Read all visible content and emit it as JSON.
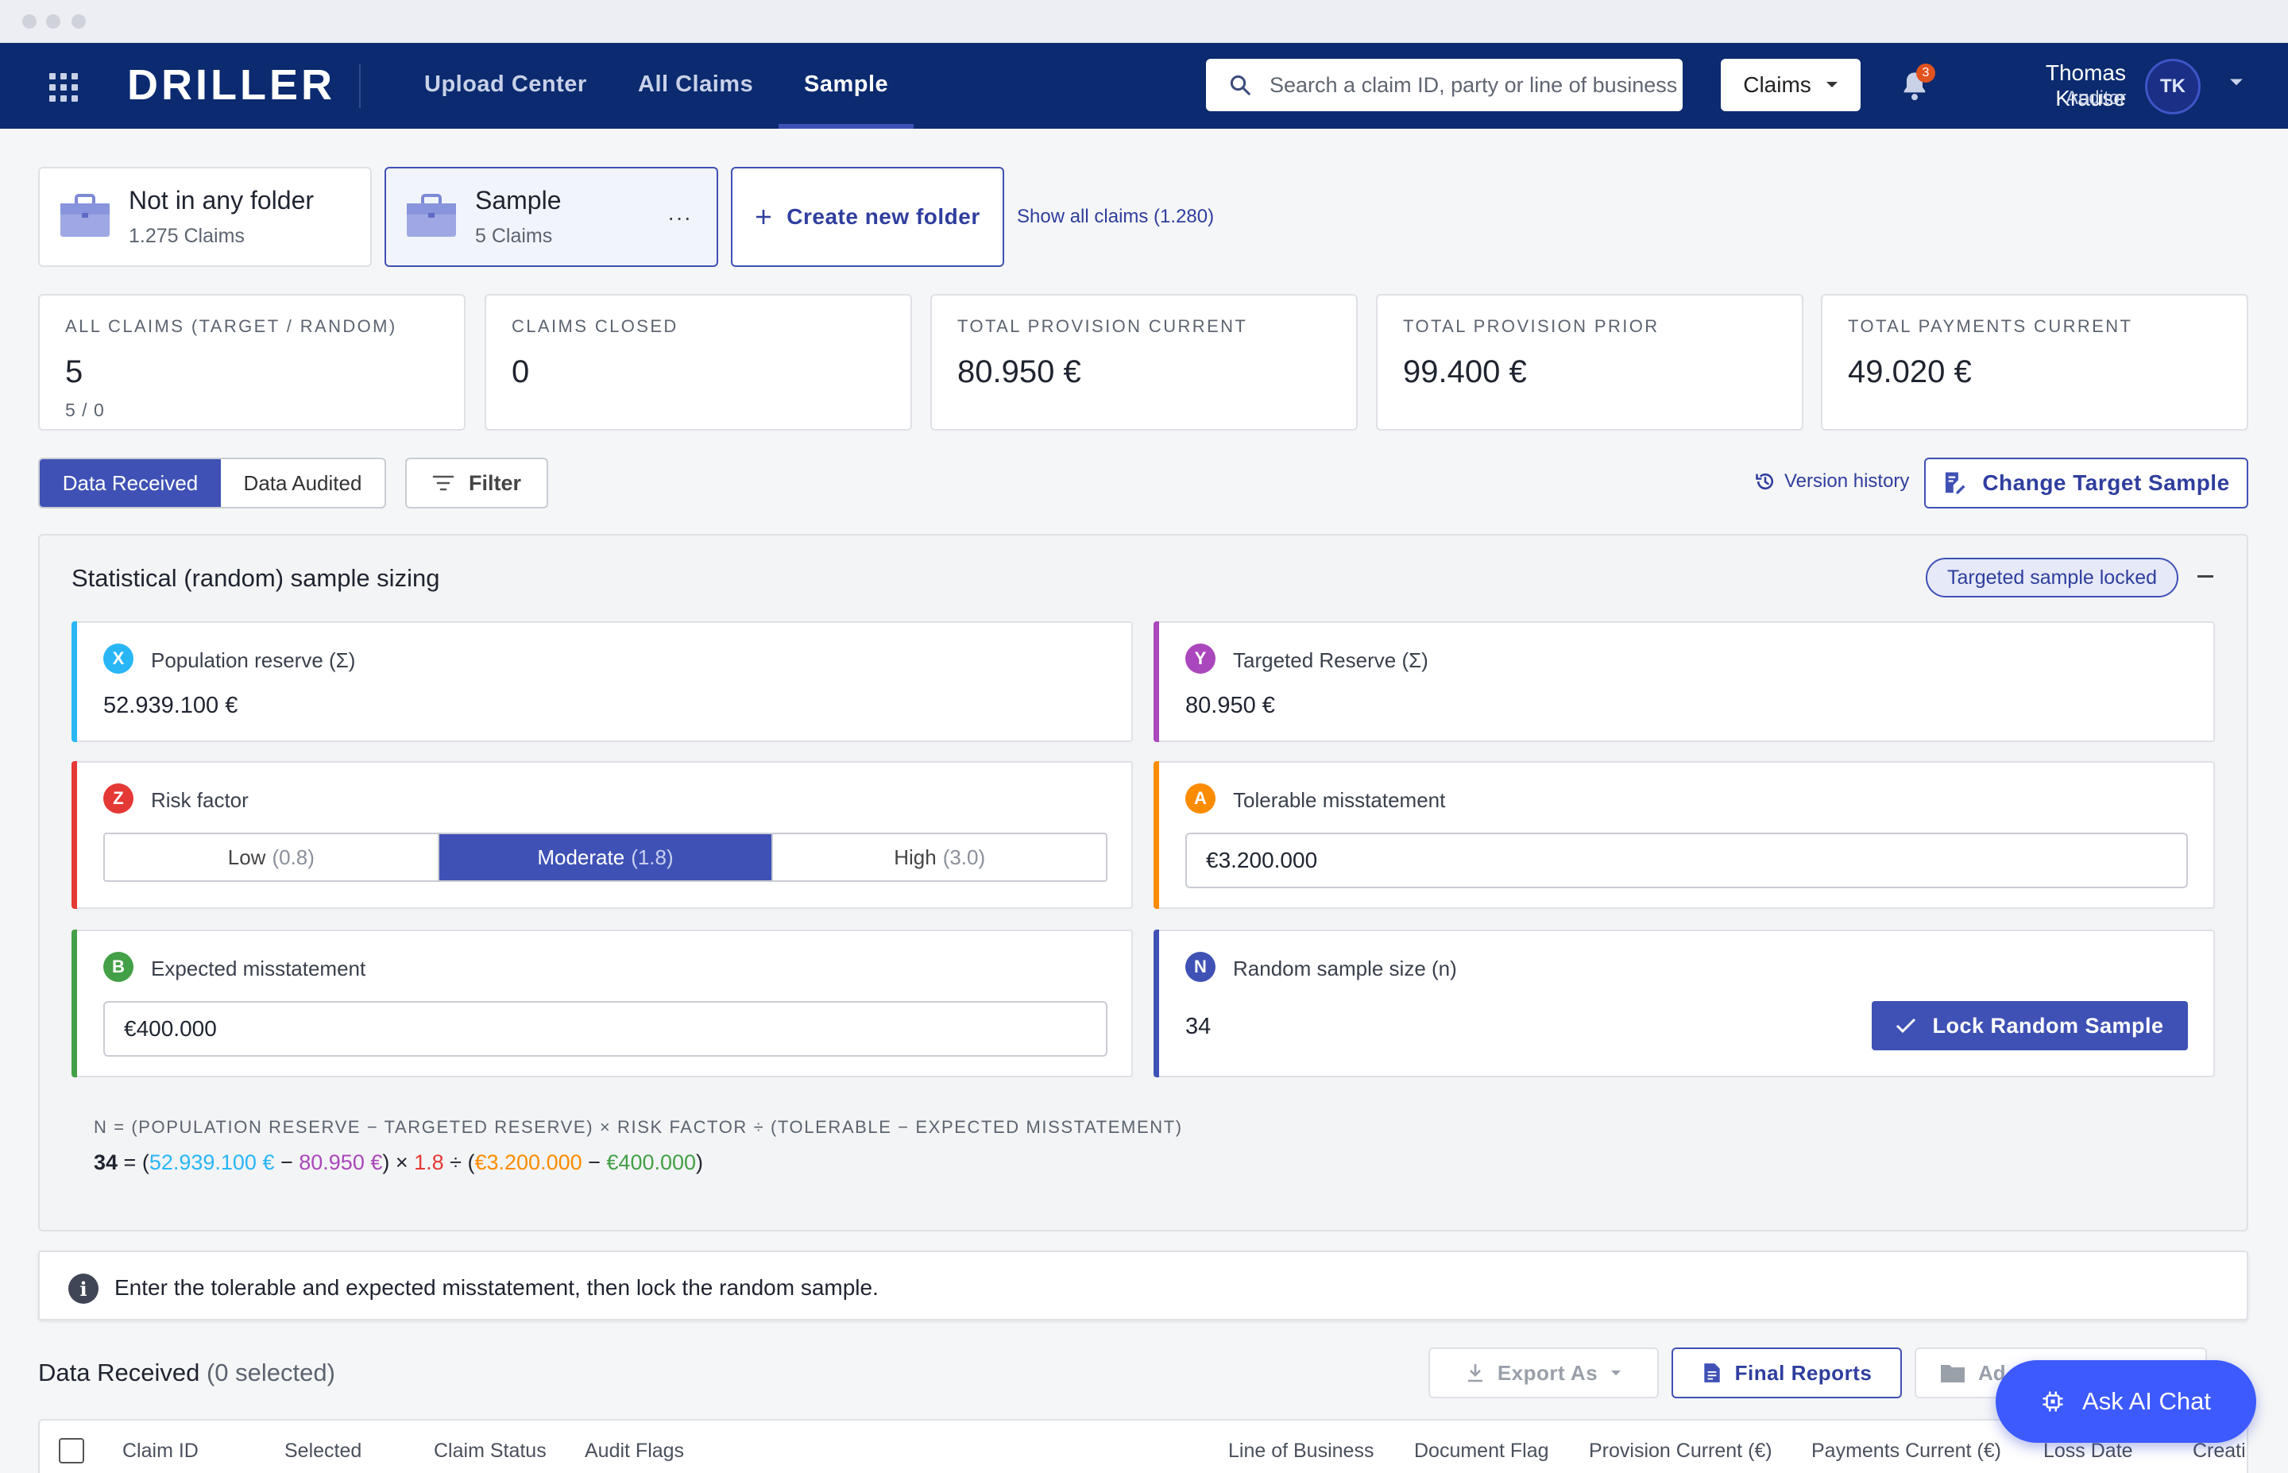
{
  "nav": {
    "brand": "DRILLER",
    "links": [
      "Upload Center",
      "All Claims",
      "Sample"
    ],
    "active_link": "Sample",
    "search_placeholder": "Search a claim ID, party or line of business",
    "scope": "Claims",
    "notifications": "3",
    "user": {
      "name": "Thomas Krause",
      "role": "Auditor",
      "initials": "TK"
    }
  },
  "folders": [
    {
      "name": "Not in any folder",
      "count": "1.275 Claims",
      "selected": false
    },
    {
      "name": "Sample",
      "count": "5 Claims",
      "selected": true,
      "menu": "···"
    }
  ],
  "create_folder_label": "Create new folder",
  "show_all_label": "Show all claims (1.280)",
  "stats": [
    {
      "label": "ALL CLAIMS (TARGET / RANDOM)",
      "value": "5",
      "sub": "5 / 0"
    },
    {
      "label": "CLAIMS CLOSED",
      "value": "0"
    },
    {
      "label": "TOTAL PROVISION CURRENT",
      "value": "80.950 €"
    },
    {
      "label": "TOTAL PROVISION PRIOR",
      "value": "99.400 €"
    },
    {
      "label": "TOTAL PAYMENTS CURRENT",
      "value": "49.020 €"
    }
  ],
  "toolbar": {
    "tabs": [
      "Data Received",
      "Data Audited"
    ],
    "active_tab": "Data Received",
    "filter_label": "Filter",
    "version_history": "Version history",
    "change_target": "Change Target Sample"
  },
  "sizing": {
    "title": "Statistical (random) sample sizing",
    "status_pill": "Targeted sample locked",
    "population": {
      "letter": "X",
      "label": "Population reserve (Σ)",
      "value": "52.939.100 €",
      "color": "#29b6f6"
    },
    "targeted": {
      "letter": "Y",
      "label": "Targeted Reserve (Σ)",
      "value": "80.950 €",
      "color": "#ab47bc"
    },
    "risk": {
      "letter": "Z",
      "label": "Risk factor",
      "color": "#e53935",
      "options": [
        {
          "label": "Low",
          "mult": "(0.8)"
        },
        {
          "label": "Moderate",
          "mult": "(1.8)"
        },
        {
          "label": "High",
          "mult": "(3.0)"
        }
      ],
      "selected": "Moderate"
    },
    "tolerable": {
      "letter": "A",
      "label": "Tolerable misstatement",
      "value": "€3.200.000",
      "color": "#fb8c00"
    },
    "expected": {
      "letter": "B",
      "label": "Expected misstatement",
      "value": "€400.000",
      "color": "#43a047"
    },
    "sample_size": {
      "letter": "N",
      "label": "Random sample size (n)",
      "value": "34",
      "color": "#3f51b5"
    },
    "lock_button": "Lock Random Sample",
    "formula_label": "N = (POPULATION RESERVE − TARGETED RESERVE) × RISK FACTOR ÷ (TOLERABLE − EXPECTED MISSTATEMENT)",
    "formula": {
      "n": "34",
      "eq": " = (",
      "x": "52.939.100 €",
      "minus1": " − ",
      "y": "80.950 €",
      "times": ") × ",
      "z": "1.8",
      "div": " ÷ (",
      "a": "€3.200.000",
      "minus2": " − ",
      "b": "€400.000",
      "close": ")"
    }
  },
  "info_message": "Enter the tolerable and expected misstatement, then lock the random sample.",
  "data_received": {
    "title": "Data Received",
    "selected": "(0 selected)",
    "export_label": "Export As",
    "final_reports_label": "Final Reports",
    "add_label": "Ad",
    "columns": [
      "Claim ID",
      "Selected",
      "Claim Status",
      "Audit Flags",
      "Line of Business",
      "Document Flag",
      "Provision Current (€)",
      "Payments Current (€)",
      "Loss Date",
      "Creati"
    ]
  },
  "ai_chat_label": "Ask AI Chat"
}
